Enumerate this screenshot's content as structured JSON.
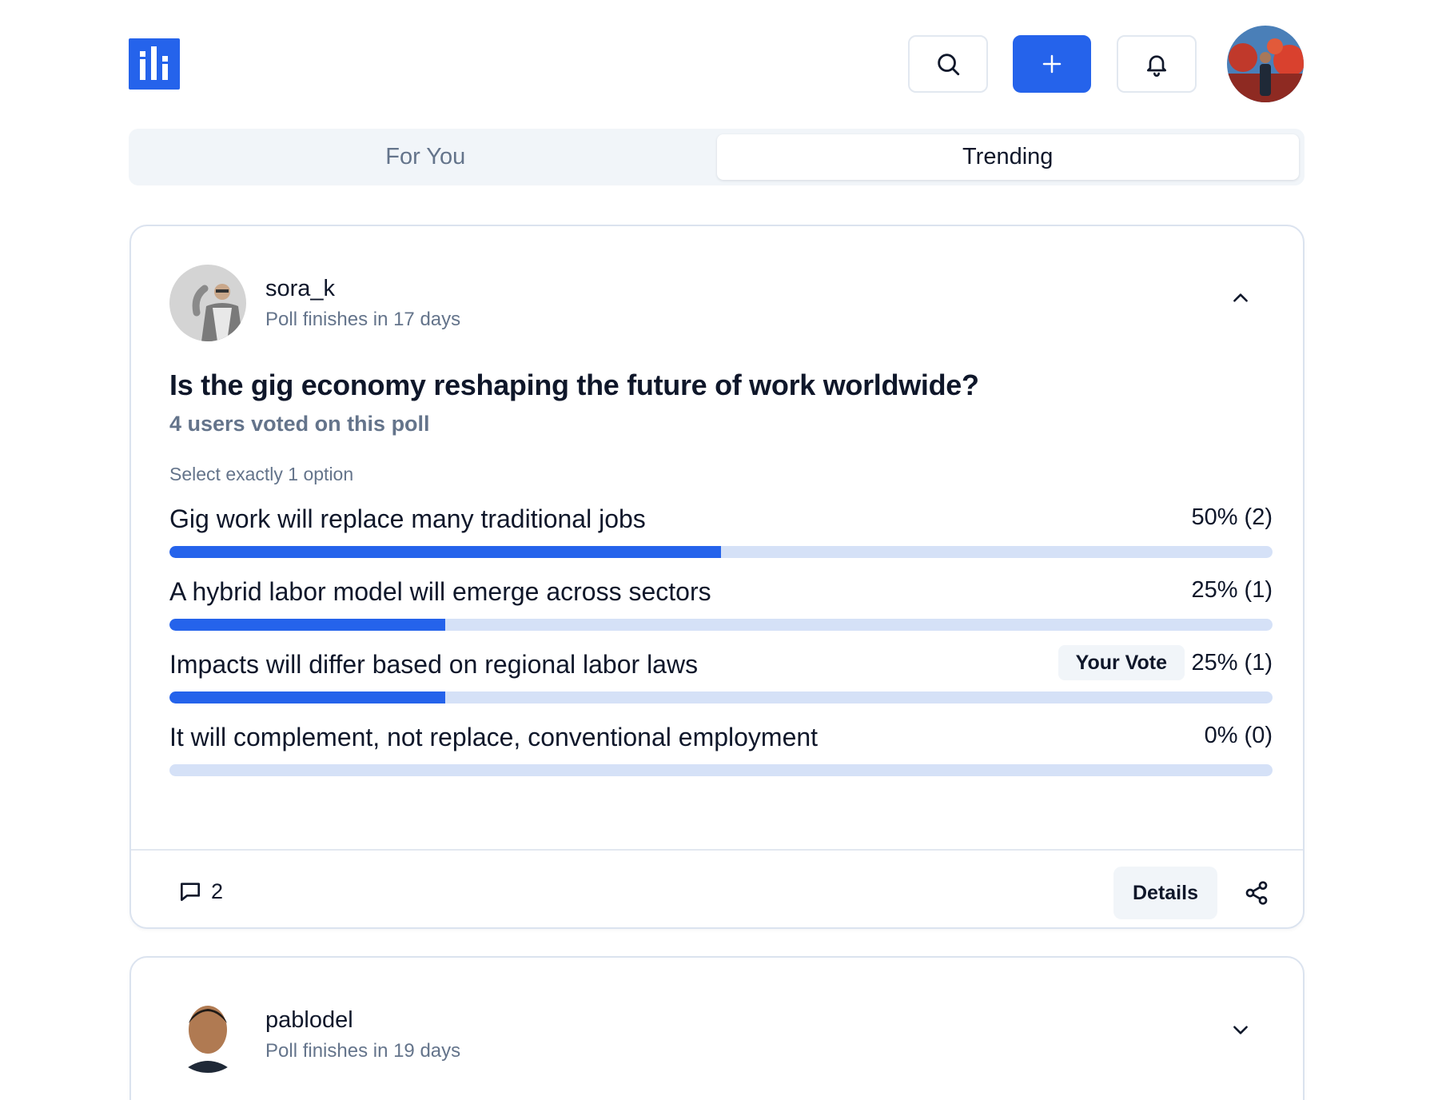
{
  "header": {
    "logo_icon": "bar-chart-logo-icon",
    "search_icon": "search-icon",
    "create_icon": "plus-icon",
    "notifications_icon": "bell-icon",
    "avatar": "user-avatar"
  },
  "tabs": [
    {
      "label": "For You",
      "active": false
    },
    {
      "label": "Trending",
      "active": true
    }
  ],
  "polls": [
    {
      "username": "sora_k",
      "finishes": "Poll finishes in 17 days",
      "expanded": true,
      "question": "Is the gig economy reshaping the future of work worldwide?",
      "votes_text": "4 users voted on this poll",
      "hint": "Select exactly 1 option",
      "options": [
        {
          "label": "Gig work will replace many traditional jobs",
          "result": "50% (2)",
          "percent": 50,
          "your_vote": false
        },
        {
          "label": "A hybrid labor model will emerge across sectors",
          "result": "25% (1)",
          "percent": 25,
          "your_vote": false
        },
        {
          "label": "Impacts will differ based on regional labor laws",
          "result": "25% (1)",
          "percent": 25,
          "your_vote": true
        },
        {
          "label": "It will complement, not replace, conventional employment",
          "result": "0% (0)",
          "percent": 0,
          "your_vote": false
        }
      ],
      "your_vote_label": "Your Vote",
      "comments": "2",
      "details_label": "Details"
    },
    {
      "username": "pablodel",
      "finishes": "Poll finishes in 19 days",
      "expanded": false
    }
  ],
  "colors": {
    "accent": "#2563eb",
    "track": "#d5e1f7",
    "muted": "#64748b"
  }
}
